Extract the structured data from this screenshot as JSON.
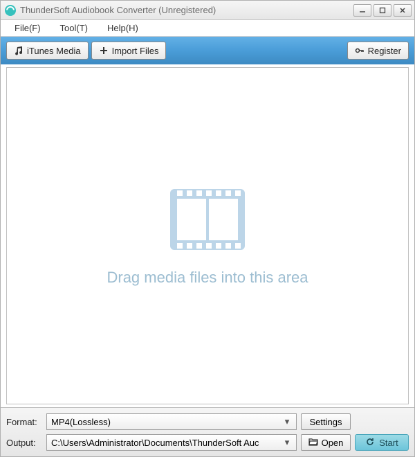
{
  "window": {
    "title": "ThunderSoft Audiobook Converter (Unregistered)"
  },
  "menu": {
    "file": "File(F)",
    "tool": "Tool(T)",
    "help": "Help(H)"
  },
  "toolbar": {
    "itunes_media": "iTunes Media",
    "import_files": "Import Files",
    "register": "Register"
  },
  "main": {
    "drop_text": "Drag media files into this area"
  },
  "bottom": {
    "format_label": "Format:",
    "format_value": "MP4(Lossless)",
    "settings": "Settings",
    "output_label": "Output:",
    "output_value": "C:\\Users\\Administrator\\Documents\\ThunderSoft Auc",
    "open": "Open",
    "start": "Start"
  },
  "colors": {
    "toolbar_blue": "#4a9dd8",
    "drop_text": "#9cbdd1",
    "film_icon": "#bcd5e8",
    "start_btn": "#6cc5da"
  }
}
